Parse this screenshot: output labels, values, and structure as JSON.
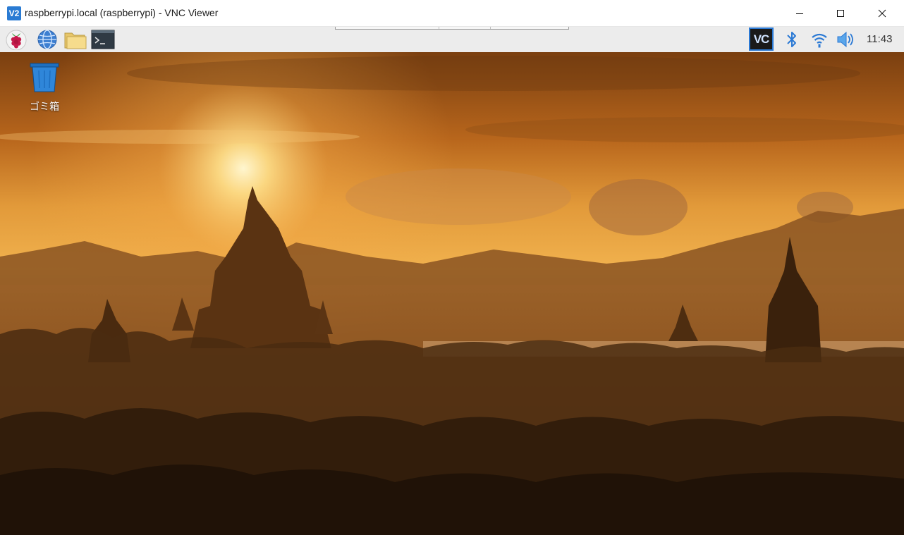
{
  "window": {
    "app_icon": "vnc-icon",
    "title": "raspberrypi.local (raspberrypi) - VNC Viewer",
    "controls": [
      "minimize-icon",
      "maximize-icon",
      "close-icon"
    ]
  },
  "panel": {
    "launchers": [
      {
        "name": "raspberry-menu-icon"
      },
      {
        "name": "web-browser-icon"
      },
      {
        "name": "file-manager-icon"
      },
      {
        "name": "terminal-icon"
      }
    ],
    "tray": {
      "vnc_label": "VC",
      "icons": [
        "vnc-server-icon",
        "bluetooth-icon",
        "wifi-icon",
        "volume-icon"
      ],
      "clock": "11:43"
    }
  },
  "desktop": {
    "items": [
      {
        "label": "ゴミ箱",
        "icon": "trash-icon"
      }
    ],
    "wallpaper": "sunset-temples"
  },
  "colors": {
    "accent": "#2b79d4",
    "panel": "#ececec",
    "sky_top": "#8a4a12",
    "sun": "#fff3c2"
  }
}
